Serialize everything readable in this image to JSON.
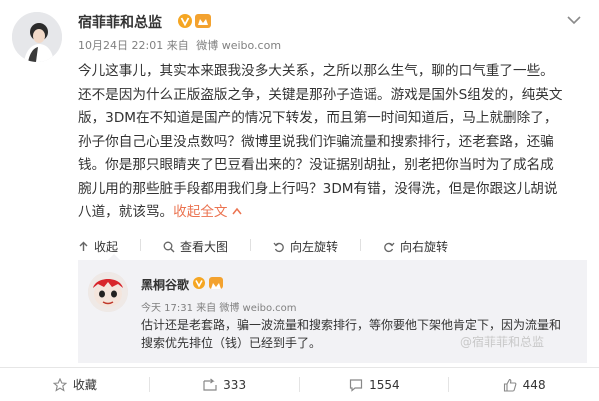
{
  "post": {
    "author": "宿菲菲和总监",
    "timestamp": "10月24日 22:01",
    "source_prefix": "来自",
    "source": "微博 weibo.com",
    "lines": [
      "今儿这事儿，其实本来跟我没多大关系，之所以那么生气，聊的口气重了一些。",
      "还不是因为什么正版盗版之争，关键是那孙子造谣。游戏是国外S组发的，纯英文",
      "版，3DM在不知道是国产的情况下转发，而且第一时间知道后，马上就删除了，",
      "孙子你自己心里没点数吗？微博里说我们诈骗流量和搜索排行，还老套路，还骗",
      "钱。你是那只眼睛夹了巴豆看出来的？没证据别胡扯，别老把你当时为了成名成",
      "腕儿用的那些脏手段都用我们身上行吗？3DM有错，没得洗，但是你跟这儿胡说",
      "八道，就该骂。"
    ],
    "collapse_label": "收起全文"
  },
  "actions": {
    "collapse": "收起",
    "view_large": "查看大图",
    "rotate_left": "向左旋转",
    "rotate_right": "向右旋转"
  },
  "repost": {
    "author": "黑桐谷歌",
    "timestamp": "今天 17:31",
    "source_prefix": "来自",
    "source": "微博 weibo.com",
    "lines": [
      "估计还是老套路，骗一波流量和搜索排行，等你要他下架他肯定下，因为流量和",
      "搜索优先排位（钱）已经到手了。"
    ],
    "watermark": "@宿菲菲和总监"
  },
  "footer": {
    "favorite": "收藏",
    "repost_count": "333",
    "comment_count": "1554",
    "like_count": "448"
  },
  "colors": {
    "accent": "#eb7350",
    "vip_badge": "#f3a22f",
    "text": "#333333",
    "meta": "#808080"
  }
}
